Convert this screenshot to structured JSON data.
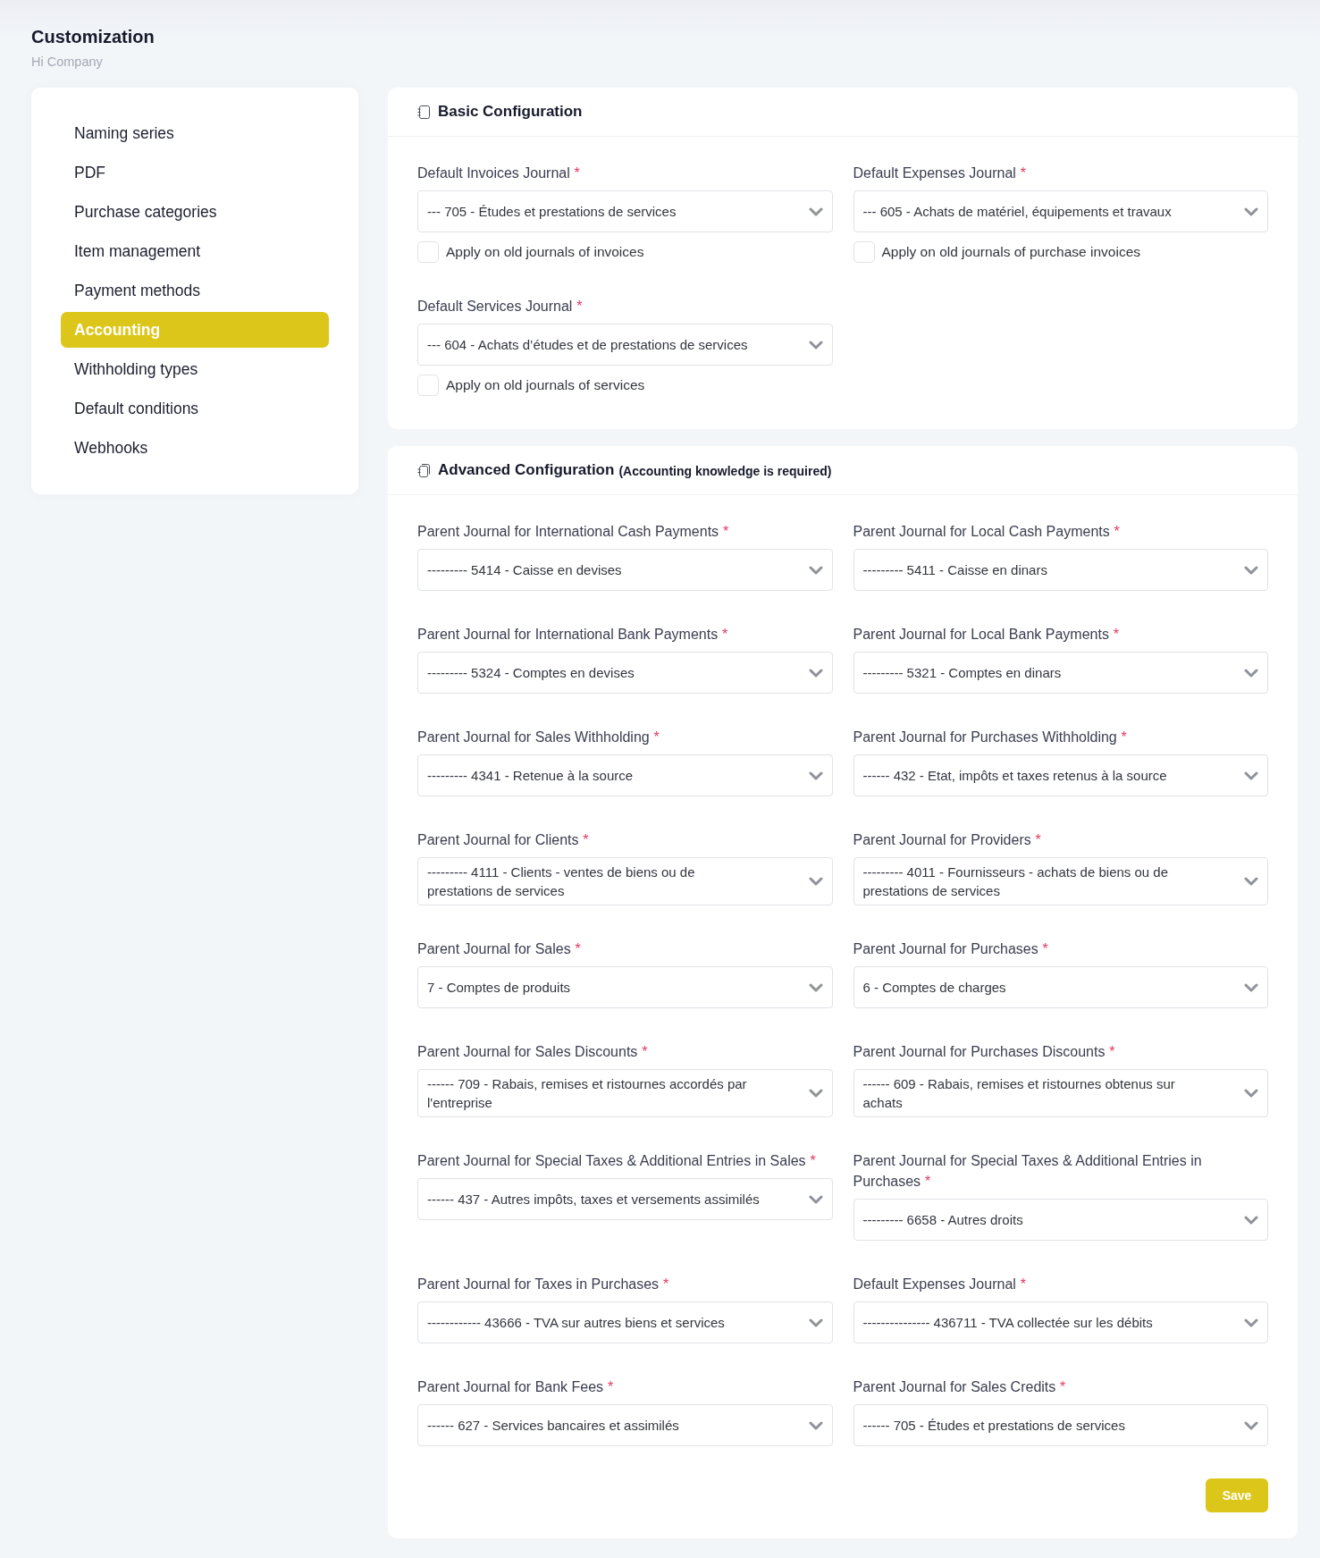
{
  "page": {
    "title": "Customization",
    "subtitle": "Hi Company"
  },
  "sidebar": {
    "items": [
      {
        "label": "Naming series",
        "selected": false
      },
      {
        "label": "PDF",
        "selected": false
      },
      {
        "label": "Purchase categories",
        "selected": false
      },
      {
        "label": "Item management",
        "selected": false
      },
      {
        "label": "Payment methods",
        "selected": false
      },
      {
        "label": "Accounting",
        "selected": true
      },
      {
        "label": "Withholding types",
        "selected": false
      },
      {
        "label": "Default conditions",
        "selected": false
      },
      {
        "label": "Webhooks",
        "selected": false
      }
    ]
  },
  "sections": [
    {
      "kind": "basic",
      "title": "Basic Configuration",
      "fields": [
        {
          "label": "Default Invoices Journal",
          "required_mark": "*",
          "value": "--- 705 - Études et prestations de services",
          "apply_old": {
            "label": "Apply on old journals of invoices",
            "checked": false
          }
        },
        {
          "label": "Default Expenses Journal",
          "required_mark": "*",
          "value": "--- 605 - Achats de matériel, équipements et travaux",
          "apply_old": {
            "label": "Apply on old journals of purchase invoices",
            "checked": false
          }
        },
        {
          "label": "Default Services Journal",
          "required_mark": "*",
          "value": "--- 604 - Achats d’études et de prestations de services",
          "apply_old": {
            "label": "Apply on old journals of services",
            "checked": false
          }
        }
      ]
    },
    {
      "kind": "advanced",
      "title": "Advanced Configuration",
      "note": "(Accounting knowledge is required)",
      "fields": [
        {
          "label": "Parent Journal for International Cash Payments",
          "required_mark": "*",
          "value": "--------- 5414 - Caisse en devises"
        },
        {
          "label": "Parent Journal for Local Cash Payments",
          "required_mark": "*",
          "value": "--------- 5411 - Caisse en dinars"
        },
        {
          "label": "Parent Journal for International Bank Payments",
          "required_mark": "*",
          "value": "--------- 5324 - Comptes en devises"
        },
        {
          "label": "Parent Journal for Local Bank Payments",
          "required_mark": "*",
          "value": "--------- 5321 - Comptes en dinars"
        },
        {
          "label": "Parent Journal for Sales Withholding",
          "required_mark": "*",
          "value": "--------- 4341 - Retenue à la source"
        },
        {
          "label": "Parent Journal for Purchases Withholding",
          "required_mark": "*",
          "value": "------ 432 - Etat, impôts et taxes retenus à la source"
        },
        {
          "label": "Parent Journal for Clients",
          "required_mark": "*",
          "value": "--------- 4111 - Clients - ventes de biens ou de prestations de services"
        },
        {
          "label": "Parent Journal for Providers",
          "required_mark": "*",
          "value": "--------- 4011 - Fournisseurs - achats de biens ou de prestations de services"
        },
        {
          "label": "Parent Journal for Sales",
          "required_mark": "*",
          "value": "7 - Comptes de produits"
        },
        {
          "label": "Parent Journal for Purchases",
          "required_mark": "*",
          "value": "6 - Comptes de charges"
        },
        {
          "label": "Parent Journal for Sales Discounts",
          "required_mark": "*",
          "value": "------ 709 - Rabais, remises et ristournes accordés par l'entreprise"
        },
        {
          "label": "Parent Journal for Purchases Discounts",
          "required_mark": "*",
          "value": "------ 609 - Rabais, remises et ristournes obtenus sur achats"
        },
        {
          "label": "Parent Journal for Special Taxes & Additional Entries in Sales",
          "required_mark": "*",
          "value": "------ 437 - Autres impôts, taxes et versements assimilés"
        },
        {
          "label": "Parent Journal for Special Taxes & Additional Entries in Purchases",
          "required_mark": "*",
          "value": "--------- 6658 - Autres droits"
        },
        {
          "label": "Parent Journal for Taxes in Purchases",
          "required_mark": "*",
          "value": "------------ 43666 - TVA sur autres biens et services"
        },
        {
          "label": "Default Expenses Journal",
          "required_mark": "*",
          "value": "--------------- 436711 - TVA collectée sur les débits"
        },
        {
          "label": "Parent Journal for Bank Fees",
          "required_mark": "*",
          "value": "------ 627 - Services bancaires et assimilés"
        },
        {
          "label": "Parent Journal for Sales Credits",
          "required_mark": "*",
          "value": "------ 705 - Études et prestations de services"
        }
      ],
      "save_button": "Save"
    }
  ]
}
